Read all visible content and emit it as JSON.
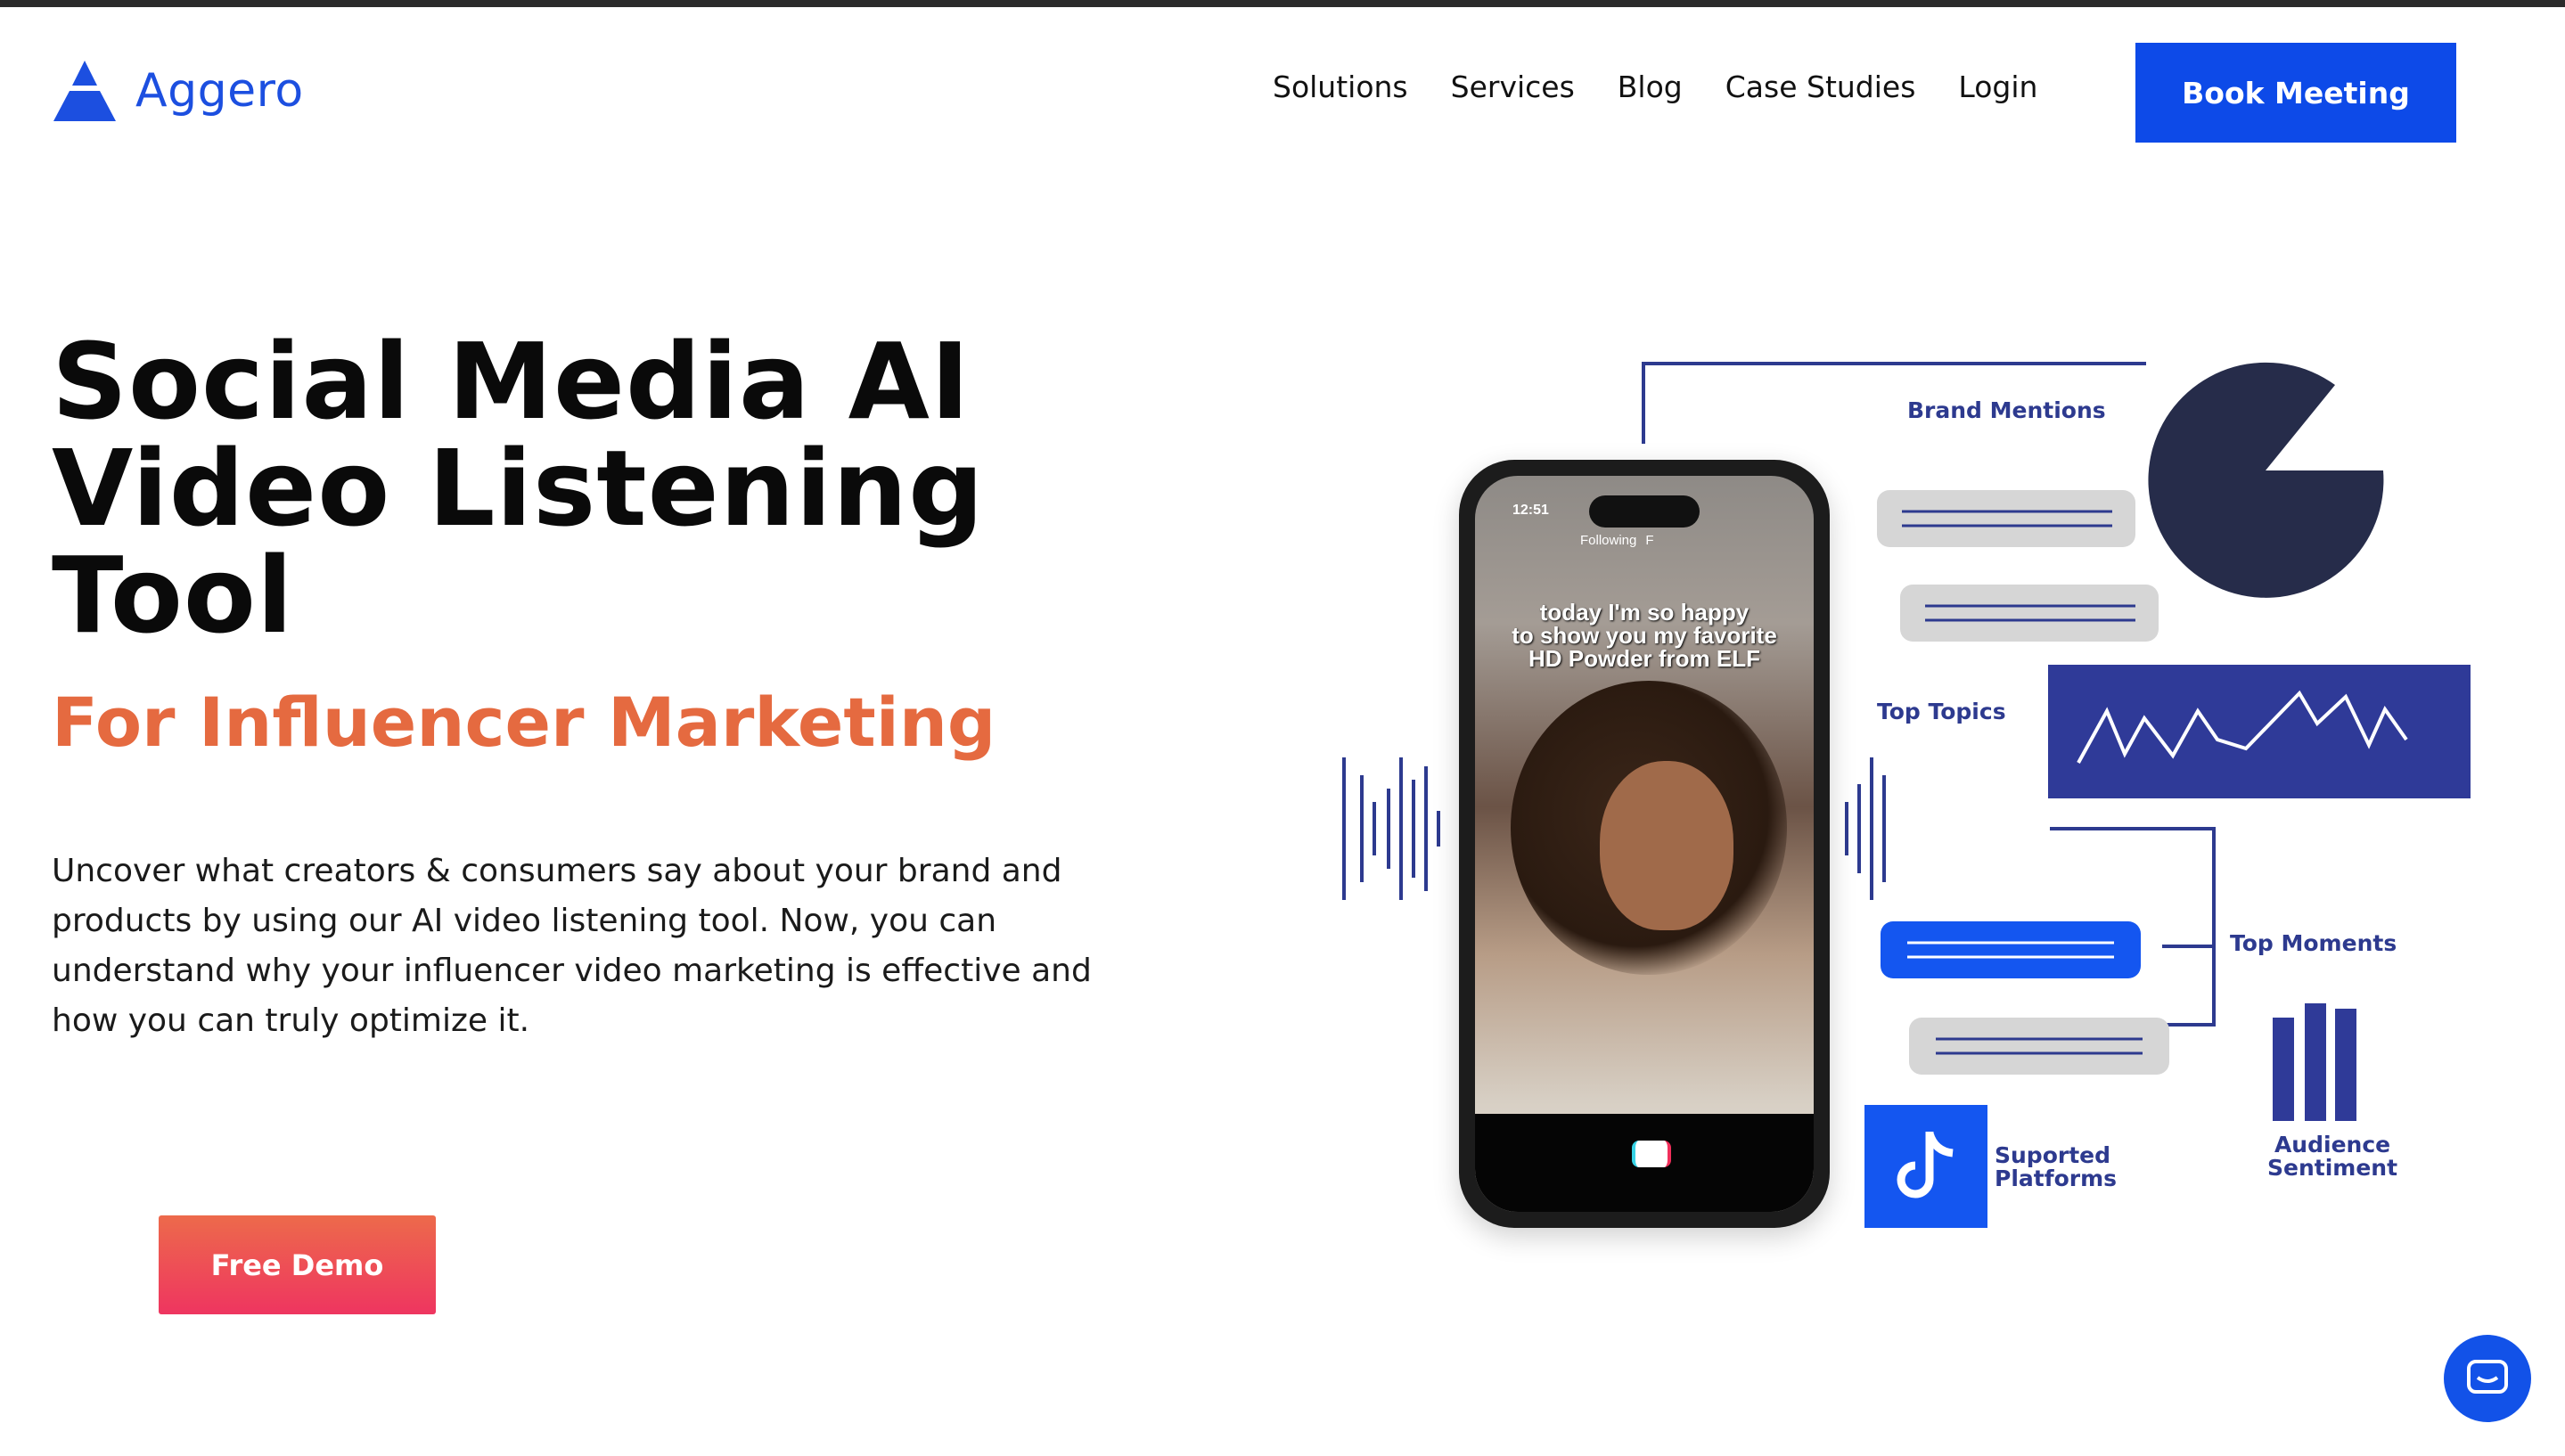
{
  "header": {
    "logo_text": "Aggero",
    "nav": [
      "Solutions",
      "Services",
      "Blog",
      "Case Studies",
      "Login"
    ],
    "cta": "Book Meeting"
  },
  "hero": {
    "title_lines": [
      "Social Media AI",
      "Video Listening",
      "Tool"
    ],
    "subtitle": "For Influencer Marketing",
    "description": "Uncover what creators & consumers say about your brand and products by using our AI video listening tool. Now, you can understand why your influencer video marketing is effective and how you can truly optimize it.",
    "demo_button": "Free Demo"
  },
  "illustration": {
    "phone_time": "12:51",
    "phone_tabs": [
      "Following",
      "F"
    ],
    "phone_caption": [
      "today I'm so happy",
      "to show you my favorite",
      "HD Powder from ELF"
    ],
    "labels": {
      "brand_mentions": "Brand Mentions",
      "top_topics": "Top Topics",
      "top_moments": "Top Moments",
      "audience_sentiment": [
        "Audience",
        "Sentiment"
      ],
      "supported_platforms": [
        "Suported",
        "Platforms"
      ]
    }
  },
  "colors": {
    "brand_blue": "#0d4ae8",
    "accent_orange": "#e56a40",
    "illustration_navy": "#2d3a8f",
    "pie_dark": "#262c4a"
  },
  "icons": [
    "logo-mark-icon",
    "tiktok-icon",
    "chat-icon"
  ]
}
